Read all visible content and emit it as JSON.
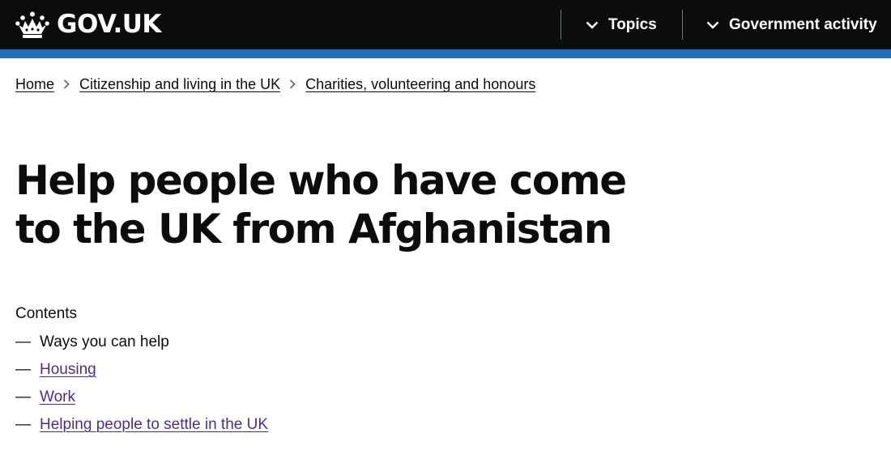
{
  "header": {
    "logo_text": "GOV.UK",
    "logo_icon": "crown-icon",
    "nav": [
      {
        "label": "Topics",
        "icon": "chevron-down-icon"
      },
      {
        "label": "Government activity",
        "icon": "chevron-down-icon"
      }
    ]
  },
  "breadcrumbs": [
    {
      "label": "Home"
    },
    {
      "label": "Citizenship and living in the UK"
    },
    {
      "label": "Charities, volunteering and honours"
    }
  ],
  "page": {
    "title": "Help people who have come to the UK from Afghanistan"
  },
  "contents": {
    "label": "Contents",
    "dash": "—",
    "items": [
      {
        "label": "Ways you can help",
        "current": true
      },
      {
        "label": "Housing",
        "current": false
      },
      {
        "label": "Work",
        "current": false
      },
      {
        "label": "Helping people to settle in the UK",
        "current": false
      }
    ]
  },
  "colors": {
    "header_bg": "#0b0c0c",
    "accent_bar": "#1d70b8",
    "link_visited": "#4c2c92",
    "text": "#0b0c0c"
  }
}
